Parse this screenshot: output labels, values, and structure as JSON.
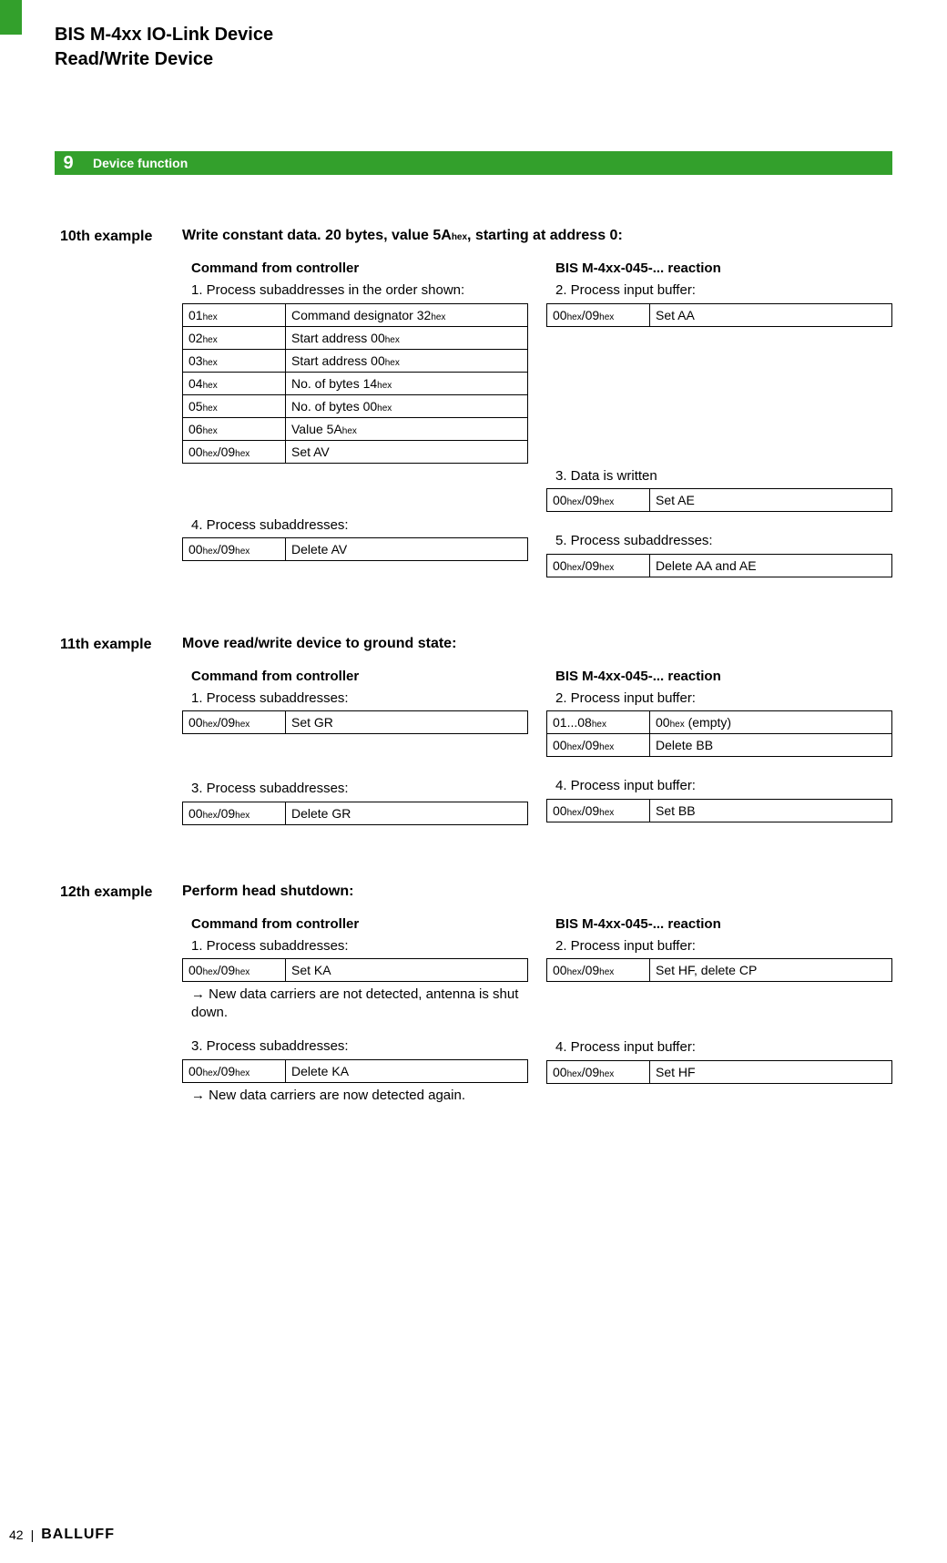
{
  "header": {
    "title_line1": "BIS M-4xx IO-Link Device",
    "title_line2": "Read/Write Device"
  },
  "section": {
    "number": "9",
    "title": "Device function"
  },
  "example10": {
    "label": "10th example",
    "title_prefix": "Write constant data. 20 bytes, value 5A",
    "title_hex": "hex",
    "title_suffix": ", starting at address 0:",
    "left_heading": "Command from controller",
    "right_heading": "BIS M-4xx-045-... reaction",
    "step1_label": "1.  Process subaddresses in the order shown:",
    "step2_label": "2.  Process input buffer:",
    "step3_label": "3.  Data is written",
    "step4_label": "4.  Process subaddresses:",
    "step5_label": "5. Process subaddresses:",
    "left_table1": [
      {
        "a_main": "01",
        "a_sub": "hex",
        "v_main": "Command designator 32",
        "v_sub": "hex"
      },
      {
        "a_main": "02",
        "a_sub": "hex",
        "v_main": "Start address 00",
        "v_sub": "hex"
      },
      {
        "a_main": "03",
        "a_sub": "hex",
        "v_main": "Start address 00",
        "v_sub": "hex"
      },
      {
        "a_main": "04",
        "a_sub": "hex",
        "v_main": "No. of bytes 14",
        "v_sub": "hex"
      },
      {
        "a_main": "05",
        "a_sub": "hex",
        "v_main": "No. of bytes 00",
        "v_sub": "hex"
      },
      {
        "a_main": "06",
        "a_sub": "hex",
        "v_main": "Value 5A",
        "v_sub": "hex"
      },
      {
        "a_main": "00",
        "a_mid": "/09",
        "a_sub": "hex",
        "v_main": "Set AV",
        "v_sub": ""
      }
    ],
    "right_table2": [
      {
        "a_main": "00",
        "a_mid": "/09",
        "a_sub": "hex",
        "v_main": "Set AA"
      }
    ],
    "right_table3": [
      {
        "a_main": "00",
        "a_mid": "/09",
        "a_sub": "hex",
        "v_main": "Set AE"
      }
    ],
    "left_table4": [
      {
        "a_main": "00",
        "a_mid": "/09",
        "a_sub": "hex",
        "v_main": "Delete AV"
      }
    ],
    "right_table5": [
      {
        "a_main": "00",
        "a_mid": "/09",
        "a_sub": "hex",
        "v_main": "Delete AA and AE"
      }
    ]
  },
  "example11": {
    "label": "11th example",
    "title": "Move read/write device to ground state:",
    "left_heading": "Command from controller",
    "right_heading": "BIS M-4xx-045-... reaction",
    "step1_label": "1.  Process subaddresses:",
    "step2_label": "2.  Process input buffer:",
    "step3_label": "3.  Process subaddresses:",
    "step4_label": "4.  Process input buffer:",
    "left_table1": [
      {
        "a_main": "00",
        "a_mid": "/09",
        "a_sub": "hex",
        "v_main": "Set GR"
      }
    ],
    "right_table2": [
      {
        "a_main": "01...08",
        "a_sub": "hex",
        "v_main": "00",
        "v_sub": "hex",
        "v_after": " (empty)"
      },
      {
        "a_main": "00",
        "a_mid": "/09",
        "a_sub": "hex",
        "v_main": "Delete BB"
      }
    ],
    "left_table3": [
      {
        "a_main": "00",
        "a_mid": "/09",
        "a_sub": "hex",
        "v_main": "Delete GR"
      }
    ],
    "right_table4": [
      {
        "a_main": "00",
        "a_mid": "/09",
        "a_sub": "hex",
        "v_main": "Set BB"
      }
    ]
  },
  "example12": {
    "label": "12th example",
    "title": "Perform head shutdown:",
    "left_heading": "Command from controller",
    "right_heading": "BIS M-4xx-045-... reaction",
    "step1_label": "1.  Process subaddresses:",
    "step2_label": "2.  Process input buffer:",
    "step3_label": "3.  Process subaddresses:",
    "step4_label": "4.  Process input buffer:",
    "left_table1": [
      {
        "a_main": "00",
        "a_mid": "/09",
        "a_sub": "hex",
        "v_main": "Set KA"
      }
    ],
    "note1": "→ New data carriers are not detected, antenna is shut down.",
    "right_table2": [
      {
        "a_main": "00",
        "a_mid": "/09",
        "a_sub": "hex",
        "v_main": "Set HF, delete CP"
      }
    ],
    "left_table3": [
      {
        "a_main": "00",
        "a_mid": "/09",
        "a_sub": "hex",
        "v_main": "Delete KA"
      }
    ],
    "note2": "→ New data carriers are now detected again.",
    "right_table4": [
      {
        "a_main": "00",
        "a_mid": "/09",
        "a_sub": "hex",
        "v_main": "Set HF"
      }
    ]
  },
  "footer": {
    "page": "42",
    "brand": "BALLUFF"
  }
}
